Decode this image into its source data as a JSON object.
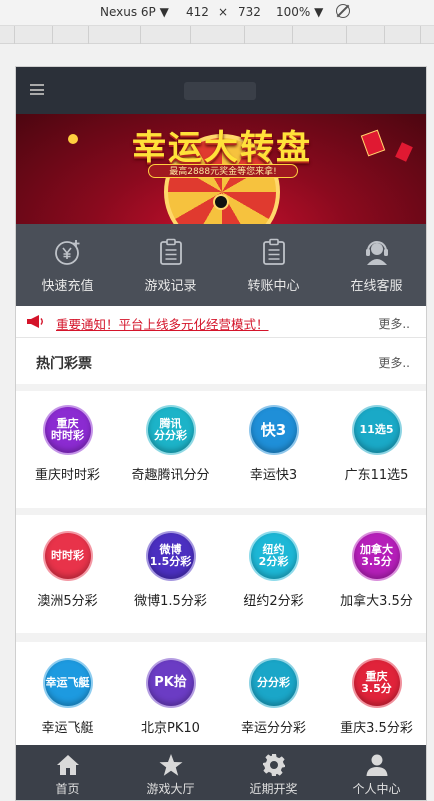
{
  "devtools": {
    "device": "Nexus 6P ▼",
    "width": "412",
    "times": "×",
    "height": "732",
    "zoom": "100% ▼"
  },
  "banner": {
    "title": "幸运大转盘",
    "subtitle": "最高2888元奖金等您来拿!"
  },
  "quicknav": [
    {
      "label": "快速充值",
      "icon": "yen-plus-icon"
    },
    {
      "label": "游戏记录",
      "icon": "clipboard-icon"
    },
    {
      "label": "转账中心",
      "icon": "clipboard-icon"
    },
    {
      "label": "在线客服",
      "icon": "headset-icon"
    }
  ],
  "notice": {
    "text": "重要通知！平台上线多元化经营模式！",
    "more": "更多.."
  },
  "hot": {
    "title": "热门彩票",
    "more": "更多.."
  },
  "lotteries": [
    {
      "label": "重庆时时彩",
      "badge": "重庆\n时时彩",
      "color": "#8b2bd1"
    },
    {
      "label": "奇趣腾讯分分",
      "badge": "腾讯\n分分彩",
      "color": "#1cb3c8"
    },
    {
      "label": "幸运快3",
      "badge": "快3",
      "color": "#1f8fd8"
    },
    {
      "label": "广东11选5",
      "badge": "11选5",
      "color": "#1aa9c7"
    },
    {
      "label": "澳洲5分彩",
      "badge": "时时彩",
      "color": "#e8334a"
    },
    {
      "label": "微博1.5分彩",
      "badge": "微博\n1.5分彩",
      "color": "#4b2fc0"
    },
    {
      "label": "纽约2分彩",
      "badge": "纽约\n2分彩",
      "color": "#1db7d6"
    },
    {
      "label": "加拿大3.5分",
      "badge": "加拿大\n3.5分",
      "color": "#b51fb9"
    },
    {
      "label": "幸运飞艇",
      "badge": "幸运飞艇",
      "color": "#1d9ae0"
    },
    {
      "label": "北京PK10",
      "badge": "PK拾",
      "color": "#6b3cc4"
    },
    {
      "label": "幸运分分彩",
      "badge": "分分彩",
      "color": "#1aa6c8"
    },
    {
      "label": "重庆3.5分彩",
      "badge": "重庆\n3.5分",
      "color": "#e0233a"
    }
  ],
  "bottomnav": [
    {
      "label": "首页",
      "icon": "home-icon"
    },
    {
      "label": "游戏大厅",
      "icon": "star-icon"
    },
    {
      "label": "近期开奖",
      "icon": "gear-icon"
    },
    {
      "label": "个人中心",
      "icon": "user-icon"
    }
  ]
}
